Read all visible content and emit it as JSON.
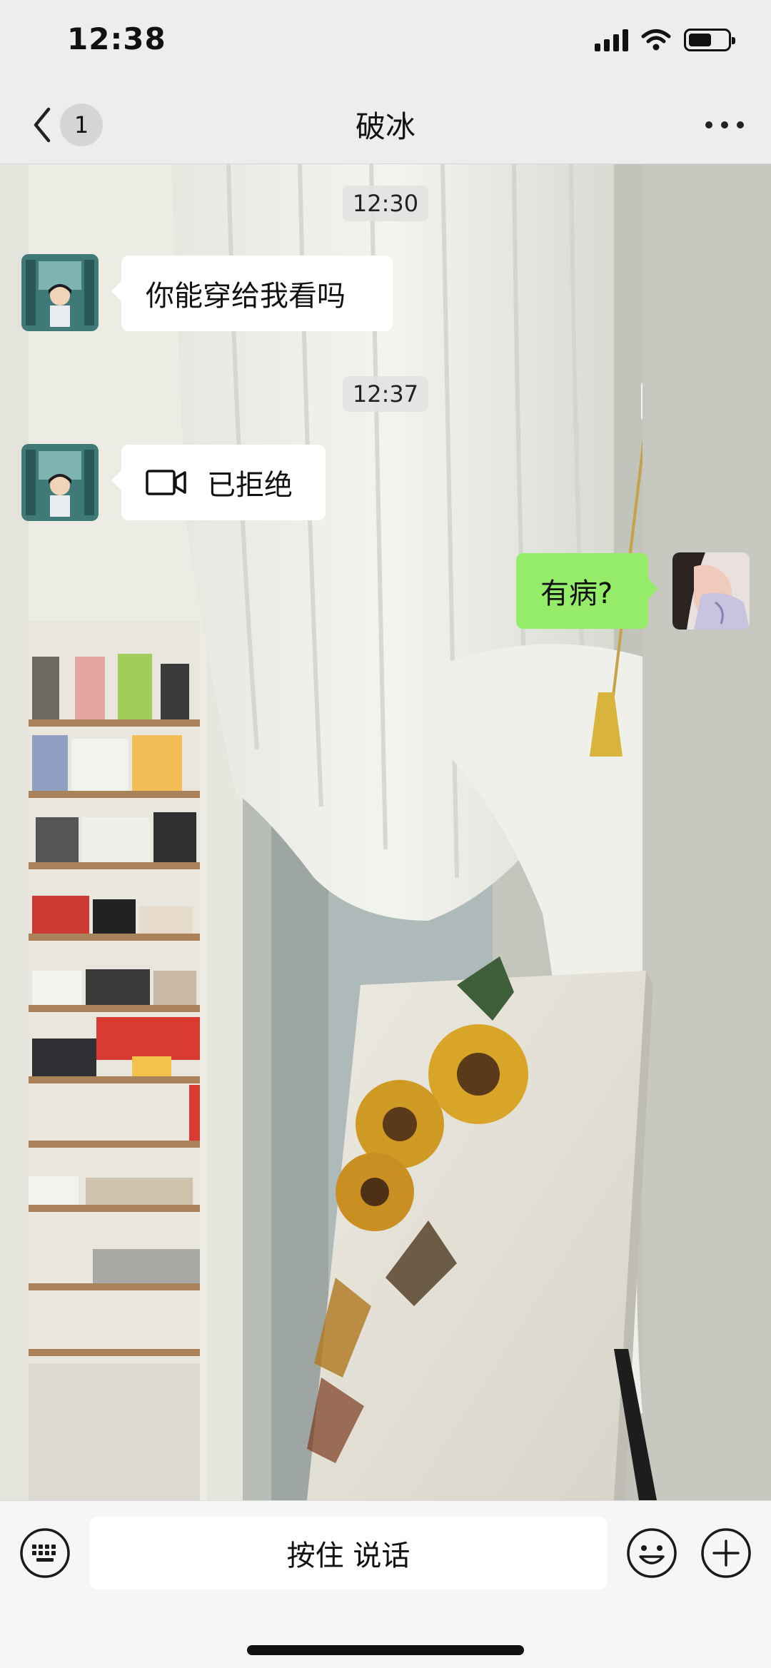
{
  "status_bar": {
    "time": "12:38",
    "icons": [
      "signal-icon",
      "wifi-icon",
      "battery-icon"
    ],
    "battery_level": 0.6
  },
  "nav": {
    "unread_count": "1",
    "title": "破冰",
    "back_icon": "chevron-left-icon",
    "more_icon": "more-dots-icon"
  },
  "chat": {
    "messages": [
      {
        "kind": "timestamp",
        "text": "12:30"
      },
      {
        "kind": "message",
        "direction": "incoming",
        "sender_avatar": "anime-boy-avatar",
        "text": "你能穿给我看吗"
      },
      {
        "kind": "timestamp",
        "text": "12:37"
      },
      {
        "kind": "call",
        "direction": "incoming",
        "sender_avatar": "anime-boy-avatar",
        "icon": "video-call-icon",
        "text": "已拒绝"
      },
      {
        "kind": "message",
        "direction": "outgoing",
        "sender_avatar": "woman-photo-avatar",
        "text": "有病?"
      }
    ]
  },
  "input_bar": {
    "voice_label": "按住 说话",
    "icons": [
      "keyboard-icon",
      "emoji-icon",
      "plus-icon"
    ]
  },
  "colors": {
    "outgoing_bubble": "#95ec69",
    "incoming_bubble": "#ffffff",
    "app_background": "#ededed"
  }
}
